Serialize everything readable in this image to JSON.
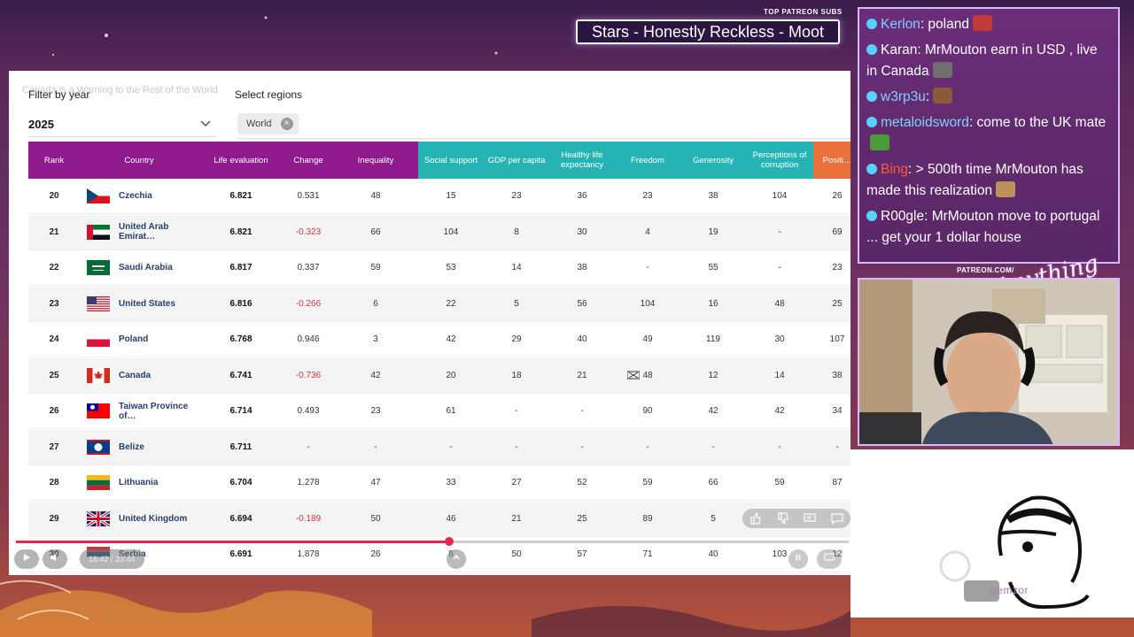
{
  "video": {
    "title": "Canada is a Warning to the Rest of the World",
    "time": "16:42 / 33:44",
    "progress": 0.52
  },
  "filters": {
    "year_label": "Filter by year",
    "year_value": "2025",
    "regions_label": "Select regions",
    "region_chip": "World"
  },
  "table": {
    "headers": [
      "Rank",
      "Country",
      "Life evaluation",
      "Change",
      "Inequality",
      "Social support",
      "GDP per capita",
      "Healthy life expectancy",
      "Freedom",
      "Generosity",
      "Perceptions of corruption",
      "Positive affect"
    ],
    "header_display": [
      "Rank",
      "Country",
      "Life evaluation",
      "Change",
      "Inequality",
      "Social support",
      "GDP per capita",
      "Healthy life expectancy",
      "Freedom",
      "Generosity",
      "Perceptions of corruption",
      "Positi…"
    ],
    "rows": [
      {
        "rank": "20",
        "country": "Czechia",
        "flag": "cz",
        "life": "6.821",
        "change": "0.531",
        "neg": false,
        "inequality": "48",
        "social": "15",
        "gdp": "23",
        "health": "36",
        "freedom": "23",
        "generosity": "38",
        "corruption": "104",
        "positive": "26"
      },
      {
        "rank": "21",
        "country": "United Arab Emirat…",
        "flag": "ae",
        "life": "6.821",
        "change": "-0.323",
        "neg": true,
        "inequality": "66",
        "social": "104",
        "gdp": "8",
        "health": "30",
        "freedom": "4",
        "generosity": "19",
        "corruption": "-",
        "positive": "69"
      },
      {
        "rank": "22",
        "country": "Saudi Arabia",
        "flag": "sa",
        "life": "6.817",
        "change": "0.337",
        "neg": false,
        "inequality": "59",
        "social": "53",
        "gdp": "14",
        "health": "38",
        "freedom": "-",
        "generosity": "55",
        "corruption": "-",
        "positive": "23"
      },
      {
        "rank": "23",
        "country": "United States",
        "flag": "us",
        "life": "6.816",
        "change": "-0.266",
        "neg": true,
        "inequality": "6",
        "social": "22",
        "gdp": "5",
        "health": "56",
        "freedom": "104",
        "generosity": "16",
        "corruption": "48",
        "positive": "25"
      },
      {
        "rank": "24",
        "country": "Poland",
        "flag": "pl",
        "life": "6.768",
        "change": "0.946",
        "neg": false,
        "inequality": "3",
        "social": "42",
        "gdp": "29",
        "health": "40",
        "freedom": "49",
        "generosity": "119",
        "corruption": "30",
        "positive": "107"
      },
      {
        "rank": "25",
        "country": "Canada",
        "flag": "ca",
        "life": "6.741",
        "change": "-0.736",
        "neg": true,
        "inequality": "42",
        "social": "20",
        "gdp": "18",
        "health": "21",
        "freedom": "48",
        "generosity": "12",
        "corruption": "14",
        "positive": "38"
      },
      {
        "rank": "26",
        "country": "Taiwan Province of…",
        "flag": "tw",
        "life": "6.714",
        "change": "0.493",
        "neg": false,
        "inequality": "23",
        "social": "61",
        "gdp": "-",
        "health": "-",
        "freedom": "90",
        "generosity": "42",
        "corruption": "42",
        "positive": "34"
      },
      {
        "rank": "27",
        "country": "Belize",
        "flag": "bz",
        "life": "6.711",
        "change": "-",
        "neg": false,
        "inequality": "-",
        "social": "-",
        "gdp": "-",
        "health": "-",
        "freedom": "-",
        "generosity": "-",
        "corruption": "-",
        "positive": "-"
      },
      {
        "rank": "28",
        "country": "Lithuania",
        "flag": "lt",
        "life": "6.704",
        "change": "1.278",
        "neg": false,
        "inequality": "47",
        "social": "33",
        "gdp": "27",
        "health": "52",
        "freedom": "59",
        "generosity": "66",
        "corruption": "59",
        "positive": "87"
      },
      {
        "rank": "29",
        "country": "United Kingdom",
        "flag": "gb",
        "life": "6.694",
        "change": "-0.189",
        "neg": true,
        "inequality": "50",
        "social": "46",
        "gdp": "21",
        "health": "25",
        "freedom": "89",
        "generosity": "5",
        "corruption": "",
        "positive": ""
      },
      {
        "rank": "30",
        "country": "Serbia",
        "flag": "rs",
        "life": "6.691",
        "change": "1.878",
        "neg": false,
        "inequality": "26",
        "social": "8",
        "gdp": "50",
        "health": "57",
        "freedom": "71",
        "generosity": "40",
        "corruption": "103",
        "positive": "12"
      }
    ]
  },
  "overlay": {
    "patreon_top": "TOP PATREON SUBS",
    "subs_banner": "Stars - Honestly Reckless - Moot",
    "patreon_com": "PATREON.COM/",
    "script_logo": "Anything Else",
    "gemzor": "gemzor"
  },
  "chat": [
    {
      "user": "Kerlon",
      "user_color": "#7fd0ff",
      "text": ": poland",
      "emote": "#c23a3a"
    },
    {
      "user": "Karan",
      "user_color": "#ffffff",
      "text": ": MrMouton earn in USD , live in Canada",
      "emote": "#6f6f6f"
    },
    {
      "user": "w3rp3u",
      "user_color": "#7fd0ff",
      "text": ":",
      "emote": "#8a5a3a"
    },
    {
      "user": "metaloidsword",
      "user_color": "#7fd0ff",
      "text": ": come to the UK mate",
      "emote": "#4c9a3c"
    },
    {
      "user": "Bing",
      "user_color": "#ff5a3a",
      "text": ": > 500th time MrMouton has made this realization",
      "emote": "#c0905a"
    },
    {
      "user": "R00gle",
      "user_color": "#ffffff",
      "text": ": MrMouton move to portugal ... get your 1 dollar house",
      "emote": ""
    }
  ]
}
